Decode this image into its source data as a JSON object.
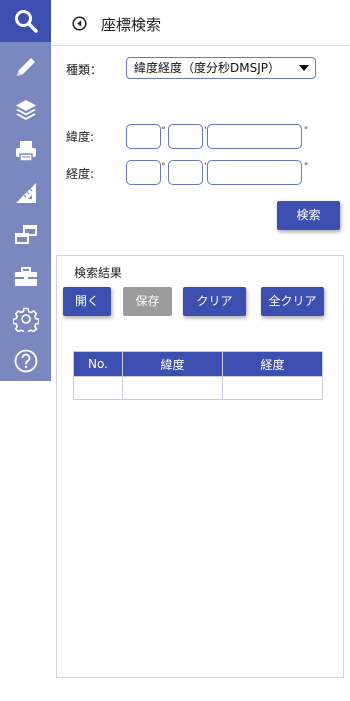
{
  "sidebar": {
    "icons": [
      "search-icon",
      "pencil-icon",
      "layers-icon",
      "printer-icon",
      "ruler-icon",
      "windows-icon",
      "toolbox-icon",
      "gear-icon",
      "help-icon"
    ],
    "active_color": "#3c4eb0",
    "rail_color": "#7b88bf"
  },
  "header": {
    "title": "座標検索"
  },
  "form": {
    "type_label": "種類：",
    "type_value": "緯度経度（度分秒DMSJP）",
    "lat_label": "緯度:",
    "lon_label": "経度:",
    "deg_unit": "°",
    "min_unit": "'",
    "sec_unit": "\"",
    "search_button": "検索"
  },
  "results": {
    "title": "検索結果",
    "buttons": {
      "open": "開く",
      "save": "保存",
      "clear": "クリア",
      "clear_all": "全クリア"
    },
    "columns": [
      "No.",
      "緯度",
      "経度"
    ],
    "rows": [
      [
        "",
        "",
        ""
      ]
    ]
  }
}
